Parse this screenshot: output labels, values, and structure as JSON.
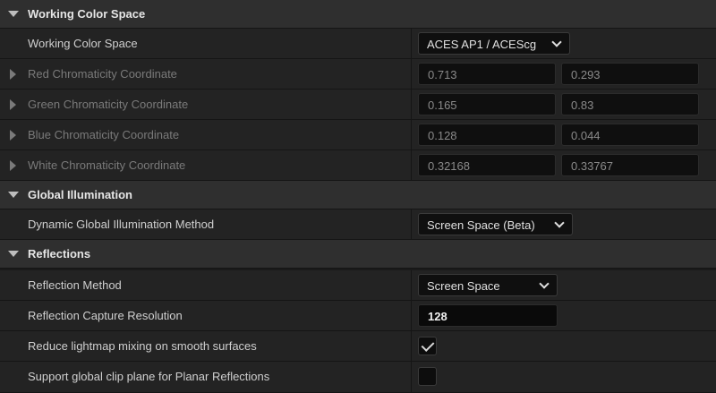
{
  "working_color_space": {
    "header": "Working Color Space",
    "working_color_space_label": "Working Color Space",
    "working_color_space_value": "ACES AP1 / ACEScg",
    "red": {
      "label": "Red Chromaticity Coordinate",
      "x": "0.713",
      "y": "0.293"
    },
    "green": {
      "label": "Green Chromaticity Coordinate",
      "x": "0.165",
      "y": "0.83"
    },
    "blue": {
      "label": "Blue Chromaticity Coordinate",
      "x": "0.128",
      "y": "0.044"
    },
    "white": {
      "label": "White Chromaticity Coordinate",
      "x": "0.32168",
      "y": "0.33767"
    }
  },
  "global_illumination": {
    "header": "Global Illumination",
    "method_label": "Dynamic Global Illumination Method",
    "method_value": "Screen Space (Beta)"
  },
  "reflections": {
    "header": "Reflections",
    "method_label": "Reflection Method",
    "method_value": "Screen Space",
    "capture_resolution_label": "Reflection Capture Resolution",
    "capture_resolution_value": "128",
    "reduce_lightmap_label": "Reduce lightmap mixing on smooth surfaces",
    "reduce_lightmap_checked": true,
    "clip_plane_label": "Support global clip plane for Planar Reflections",
    "clip_plane_checked": false
  },
  "icons": {
    "collapse": "chevron-down-icon",
    "expand": "chevron-right-icon",
    "dropdown": "chevron-down-icon",
    "check": "check-icon"
  },
  "colors": {
    "background": "#1a1a1a",
    "category_header": "#2f2f2f",
    "row": "#232323",
    "input": "#0f0f0f"
  }
}
